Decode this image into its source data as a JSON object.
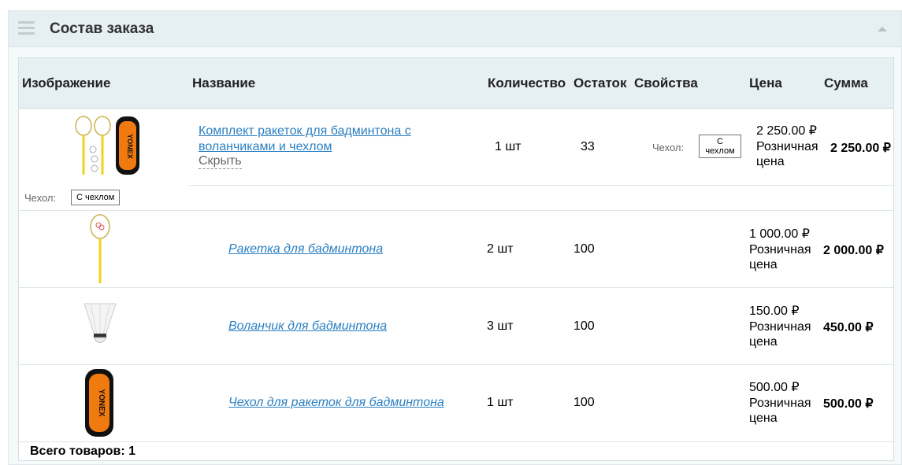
{
  "panel": {
    "title": "Состав заказа"
  },
  "columns": {
    "image": "Изображение",
    "name": "Название",
    "quantity": "Количество",
    "stock": "Остаток",
    "properties": "Свойства",
    "price": "Цена",
    "sum": "Сумма"
  },
  "set_item": {
    "name": "Комплект ракеток для бадминтона с воланчиками и чехлом",
    "hide_label": "Скрыть",
    "quantity": "1 шт",
    "stock": "33",
    "property_label": "Чехол:",
    "property_value": "С чехлом",
    "price": "2 250.00 ₽",
    "price_type": "Розничная цена",
    "sum": "2 250.00 ₽",
    "image_property_label": "Чехол:",
    "image_property_value": "С чехлом"
  },
  "set_components": [
    {
      "name": "Ракетка для бадминтона",
      "quantity": "2 шт",
      "stock": "100",
      "price": "1 000.00 ₽",
      "price_type": "Розничная цена",
      "sum": "2 000.00 ₽"
    },
    {
      "name": "Воланчик для бадминтона",
      "quantity": "3 шт",
      "stock": "100",
      "price": "150.00 ₽",
      "price_type": "Розничная цена",
      "sum": "450.00 ₽"
    },
    {
      "name": "Чехол для ракеток для бадминтона",
      "quantity": "1 шт",
      "stock": "100",
      "price": "500.00 ₽",
      "price_type": "Розничная цена",
      "sum": "500.00 ₽"
    }
  ],
  "footer": {
    "total_label": "Всего товаров: 1"
  },
  "colors": {
    "accent_link": "#2a7fc2",
    "header_bg": "#e6eff1",
    "bag_orange": "#f07a10",
    "racket_yellow": "#f2d21a"
  }
}
